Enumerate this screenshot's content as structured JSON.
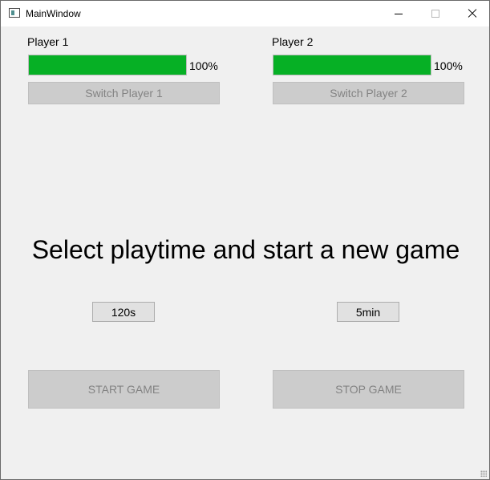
{
  "window": {
    "title": "MainWindow"
  },
  "players": [
    {
      "name": "Player 1",
      "progress": 1.0,
      "progress_text": "100%",
      "switch_label": "Switch Player 1"
    },
    {
      "name": "Player 2",
      "progress": 1.0,
      "progress_text": "100%",
      "switch_label": "Switch Player 2"
    }
  ],
  "main": {
    "headline": "Select playtime and start a new game",
    "playtime_options": [
      "120s",
      "5min"
    ],
    "start_label": "START GAME",
    "stop_label": "STOP GAME"
  },
  "colors": {
    "progress_fill": "#06b025",
    "window_bg": "#f0f0f0",
    "disabled_button_bg": "#cccccc",
    "disabled_button_text": "#838383"
  },
  "icons": {
    "app": "window-icon",
    "minimize": "minimize-icon",
    "maximize": "maximize-icon",
    "close": "close-icon"
  }
}
